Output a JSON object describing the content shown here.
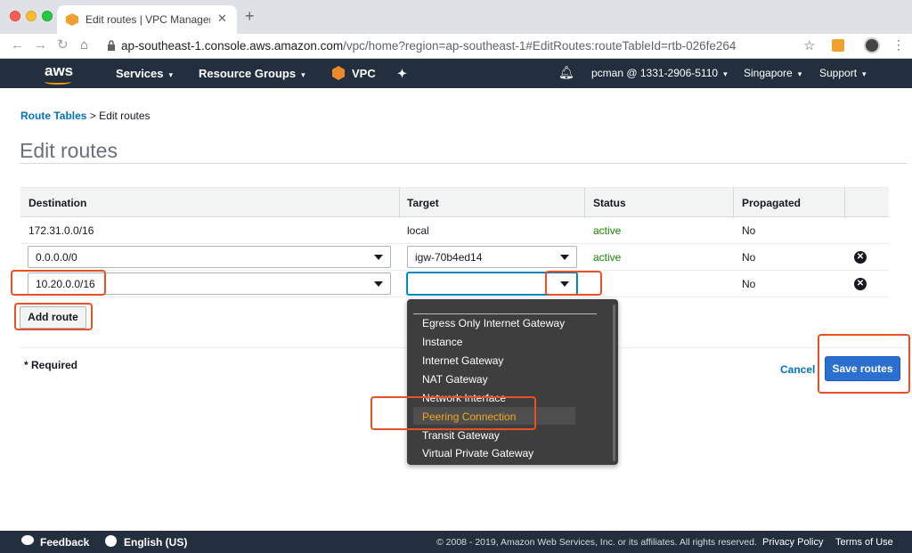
{
  "browser": {
    "tab_title": "Edit routes | VPC Management",
    "tab_close": "✕",
    "new_tab": "+",
    "url_host": "ap-southeast-1.console.aws.amazon.com",
    "url_path": "/vpc/home?region=ap-southeast-1#EditRoutes:routeTableId=rtb-026fe264"
  },
  "awsnav": {
    "logo": "aws",
    "services": "Services",
    "resource_groups": "Resource Groups",
    "vpc": "VPC",
    "account": "pcman @ 1331-2906-5110",
    "region": "Singapore",
    "support": "Support"
  },
  "breadcrumb": {
    "parent": "Route Tables",
    "separator": " > ",
    "current": "Edit routes"
  },
  "page_title": "Edit routes",
  "table": {
    "headers": [
      "Destination",
      "Target",
      "Status",
      "Propagated"
    ],
    "rows": [
      {
        "destination": "172.31.0.0/16",
        "target": "local",
        "status": "active",
        "propagated": "No"
      },
      {
        "destination": "0.0.0.0/0",
        "target": "igw-70b4ed14",
        "status": "active",
        "propagated": "No"
      },
      {
        "destination": "10.20.0.0/16",
        "target": "",
        "status": "",
        "propagated": "No"
      }
    ]
  },
  "add_route": "Add route",
  "required": "* Required",
  "cancel": "Cancel",
  "save_routes": "Save routes",
  "dropdown": {
    "items": [
      "Egress Only Internet Gateway",
      "Instance",
      "Internet Gateway",
      "NAT Gateway",
      "Network Interface",
      "Peering Connection",
      "Transit Gateway",
      "Virtual Private Gateway"
    ],
    "highlighted": "Peering Connection"
  },
  "footer": {
    "feedback": "Feedback",
    "language": "English (US)",
    "copyright": "© 2008 - 2019, Amazon Web Services, Inc. or its affiliates. All rights reserved.",
    "privacy": "Privacy Policy",
    "terms": "Terms of Use"
  },
  "colors": {
    "aws_nav": "#232f3e",
    "link": "#0073bb",
    "active": "#1d8102",
    "primary": "#2b6fd1",
    "annotation": "#e8502a",
    "dropdown_highlight": "#f5a623"
  }
}
